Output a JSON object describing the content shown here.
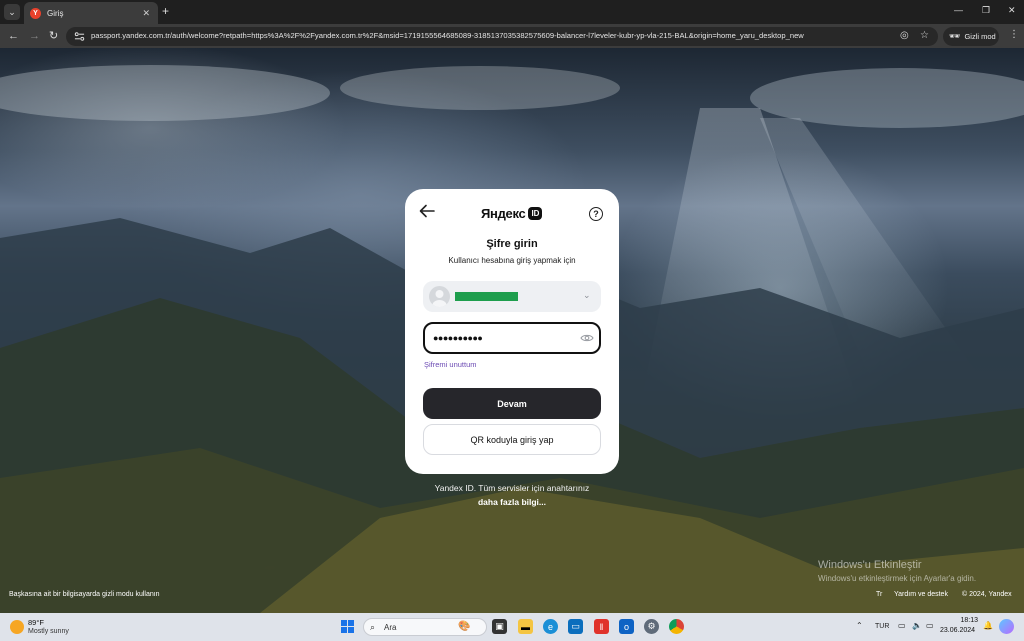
{
  "browser": {
    "tab_title": "Giriş",
    "tab_favicon": "yandex-y-icon",
    "url": "passport.yandex.com.tr/auth/welcome?retpath=https%3A%2F%2Fyandex.com.tr%2F&msid=1719155564685089-3185137035382575609-balancer-l7leveler-kubr-yp-vla-215-BAL&origin=home_yaru_desktop_new",
    "incognito_label": "Gizli mod"
  },
  "card": {
    "logo_text": "Яндекс",
    "logo_badge": "ID",
    "title": "Şifre girin",
    "subtitle": "Kullanıcı hesabına giriş yapmak için",
    "password_value": "●●●●●●●●●●",
    "forgot_label": "Şifremi unuttum",
    "continue_label": "Devam",
    "qr_label": "QR koduyla giriş yap"
  },
  "page": {
    "tagline": "Yandex ID. Tüm servisler için anahtarınız",
    "more_label": "daha fazla bilgi...",
    "incognito_note": "Başkasına ait bir bilgisayarda gizli modu kullanın",
    "lang": "Tr",
    "help_label": "Yardım ve destek",
    "copyright": "© 2024, Yandex",
    "activate_title": "Windows'u Etkinleştir",
    "activate_sub": "Windows'u etkinleştirmek için Ayarlar'a gidin."
  },
  "taskbar": {
    "temp": "89°F",
    "weather": "Mostly sunny",
    "search_label": "Ara",
    "lang": "TUR",
    "time": "18:13",
    "date": "23.06.2024"
  },
  "colors": {
    "accent_link": "#6c4bb4",
    "primary_button": "#26262b",
    "account_mask": "#1e9e4d"
  }
}
